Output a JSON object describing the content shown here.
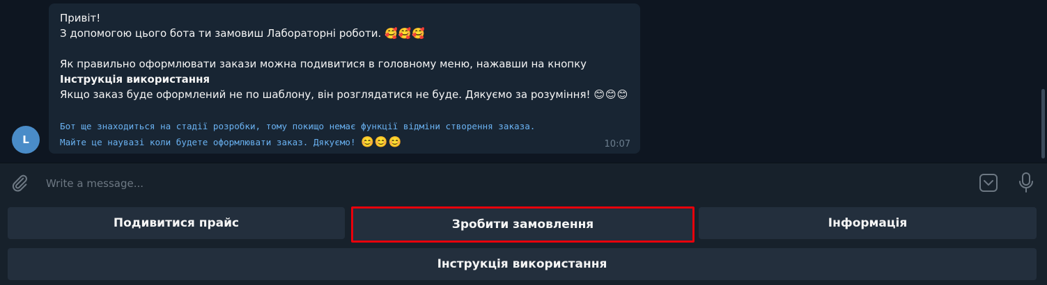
{
  "message": {
    "lines": [
      "Привіт!",
      "З допомогою цього бота ти замовиш Лабораторні роботи.",
      "Як правильно оформлювати закази можна подивитися в головному меню, нажавши на кнопку",
      "Інструкція використання",
      "Якщо заказ буде оформлений не по шаблону, він розглядатися не буде. Дякуємо за розуміння!"
    ],
    "line2_emoji": "🥰🥰🥰",
    "line5_emoji": "😊😊😊",
    "mono_lines": [
      "Бот ще знаходиться на стадії розробки, тому покищо немає функції відміни створення заказа.",
      "Майте це наувазі коли будете оформлювати заказ. Дякуємо!"
    ],
    "mono_emoji": "😊😊😊",
    "time": "10:07"
  },
  "avatar": {
    "letter": "L",
    "color": "#4a8cc8"
  },
  "composer": {
    "placeholder": "Write a message..."
  },
  "keyboard": {
    "row1": [
      "Подивитися прайс",
      "Зробити замовлення",
      "Інформація"
    ],
    "row2": [
      "Інструкція використання"
    ],
    "highlighted": "Зробити замовлення"
  },
  "icons": [
    "paperclip-icon",
    "bot-command-icon",
    "microphone-icon"
  ],
  "colors": {
    "background": "#0e1621",
    "bubble": "#182533",
    "panel": "#17212b",
    "button": "#232f3d",
    "highlight": "#e8000b",
    "code": "#6ab2f2"
  }
}
